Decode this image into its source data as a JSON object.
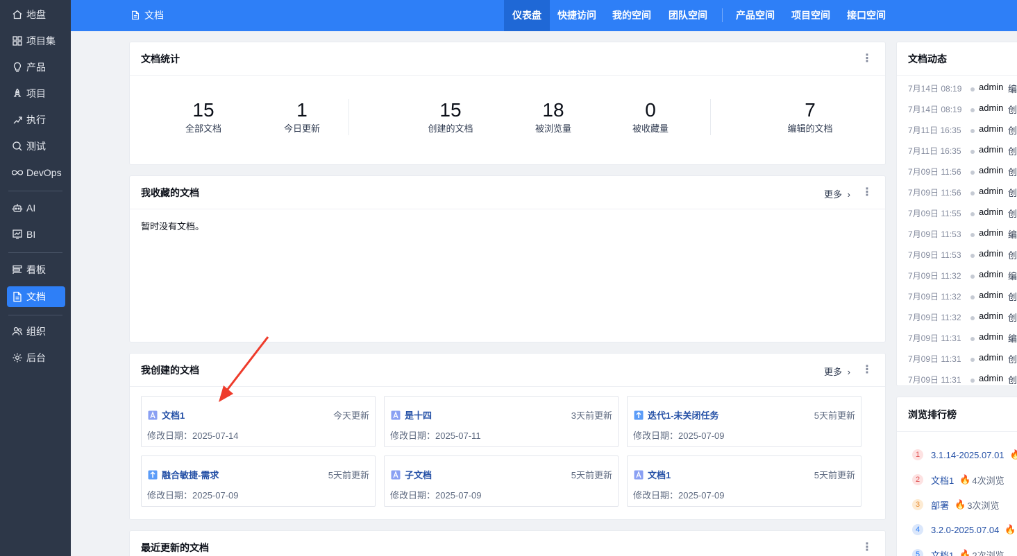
{
  "sidebar": {
    "items": [
      {
        "label": "地盘",
        "icon": "home-icon"
      },
      {
        "label": "项目集",
        "icon": "grid-icon"
      },
      {
        "label": "产品",
        "icon": "bulb-icon"
      },
      {
        "label": "项目",
        "icon": "rocket-icon"
      },
      {
        "label": "执行",
        "icon": "run-icon"
      },
      {
        "label": "测试",
        "icon": "magnifier-icon"
      },
      {
        "label": "DevOps",
        "icon": "infinity-icon"
      },
      {
        "label": "AI",
        "icon": "robot-icon"
      },
      {
        "label": "BI",
        "icon": "chart-icon"
      },
      {
        "label": "看板",
        "icon": "kanban-icon"
      },
      {
        "label": "文档",
        "icon": "document-icon"
      },
      {
        "label": "组织",
        "icon": "people-icon"
      },
      {
        "label": "后台",
        "icon": "gear-icon"
      }
    ],
    "active": "文档"
  },
  "header": {
    "title": "文档",
    "nav": [
      "仪表盘",
      "快捷访问",
      "我的空间",
      "团队空间",
      "产品空间",
      "项目空间",
      "接口空间"
    ],
    "active": "仪表盘"
  },
  "stats_card": {
    "title": "文档统计",
    "stats": [
      {
        "value": "15",
        "label": "全部文档"
      },
      {
        "value": "1",
        "label": "今日更新"
      },
      {
        "value": "15",
        "label": "创建的文档"
      },
      {
        "value": "18",
        "label": "被浏览量"
      },
      {
        "value": "0",
        "label": "被收藏量"
      },
      {
        "value": "7",
        "label": "编辑的文档"
      }
    ]
  },
  "fav_card": {
    "title": "我收藏的文档",
    "more": "更多",
    "empty": "暂时没有文档。"
  },
  "created_card": {
    "title": "我创建的文档",
    "more": "更多",
    "date_prefix": "修改日期：",
    "docs": [
      {
        "name": "文档1",
        "updated": "今天更新",
        "date": "2025-07-14",
        "icon": "text-doc-icon"
      },
      {
        "name": "是十四",
        "updated": "3天前更新",
        "date": "2025-07-11",
        "icon": "text-doc-icon"
      },
      {
        "name": "迭代1-未关闭任务",
        "updated": "5天前更新",
        "date": "2025-07-09",
        "icon": "report-doc-icon"
      },
      {
        "name": "融合敏捷-需求",
        "updated": "5天前更新",
        "date": "2025-07-09",
        "icon": "report-doc-icon"
      },
      {
        "name": "子文档",
        "updated": "5天前更新",
        "date": "2025-07-09",
        "icon": "text-doc-icon"
      },
      {
        "name": "文档1",
        "updated": "5天前更新",
        "date": "2025-07-09",
        "icon": "text-doc-icon"
      }
    ]
  },
  "recent_card": {
    "title": "最近更新的文档"
  },
  "dynamics": {
    "title": "文档动态",
    "rows": [
      {
        "time": "7月14日 08:19",
        "user": "admin",
        "action": "编"
      },
      {
        "time": "7月14日 08:19",
        "user": "admin",
        "action": "创"
      },
      {
        "time": "7月11日 16:35",
        "user": "admin",
        "action": "创"
      },
      {
        "time": "7月11日 16:35",
        "user": "admin",
        "action": "创"
      },
      {
        "time": "7月09日 11:56",
        "user": "admin",
        "action": "创"
      },
      {
        "time": "7月09日 11:56",
        "user": "admin",
        "action": "创"
      },
      {
        "time": "7月09日 11:55",
        "user": "admin",
        "action": "创"
      },
      {
        "time": "7月09日 11:53",
        "user": "admin",
        "action": "编"
      },
      {
        "time": "7月09日 11:53",
        "user": "admin",
        "action": "创"
      },
      {
        "time": "7月09日 11:32",
        "user": "admin",
        "action": "编"
      },
      {
        "time": "7月09日 11:32",
        "user": "admin",
        "action": "创"
      },
      {
        "time": "7月09日 11:32",
        "user": "admin",
        "action": "创"
      },
      {
        "time": "7月09日 11:31",
        "user": "admin",
        "action": "编"
      },
      {
        "time": "7月09日 11:31",
        "user": "admin",
        "action": "创"
      },
      {
        "time": "7月09日 11:31",
        "user": "admin",
        "action": "创"
      }
    ]
  },
  "ranking": {
    "title": "浏览排行榜",
    "rows": [
      {
        "rank": "1",
        "name": "3.1.14-2025.07.01",
        "count": ""
      },
      {
        "rank": "2",
        "name": "文档1",
        "count": "4次浏览"
      },
      {
        "rank": "3",
        "name": "部署",
        "count": "3次浏览"
      },
      {
        "rank": "4",
        "name": "3.2.0-2025.07.04",
        "count": ""
      },
      {
        "rank": "5",
        "name": "文档1",
        "count": "2次浏览"
      }
    ],
    "rank_colors": [
      "#fde2e2",
      "#fde2e2",
      "#fdebd3",
      "#dbe7fb",
      "#dbe7fb"
    ],
    "rank_text_colors": [
      "#e05252",
      "#e05252",
      "#e8903a",
      "#2e7ff7",
      "#2e7ff7"
    ]
  },
  "colors": {
    "primary": "#2e7ff7",
    "sidebar_bg": "#2d3748",
    "annotation_arrow": "#ee3b2b"
  }
}
